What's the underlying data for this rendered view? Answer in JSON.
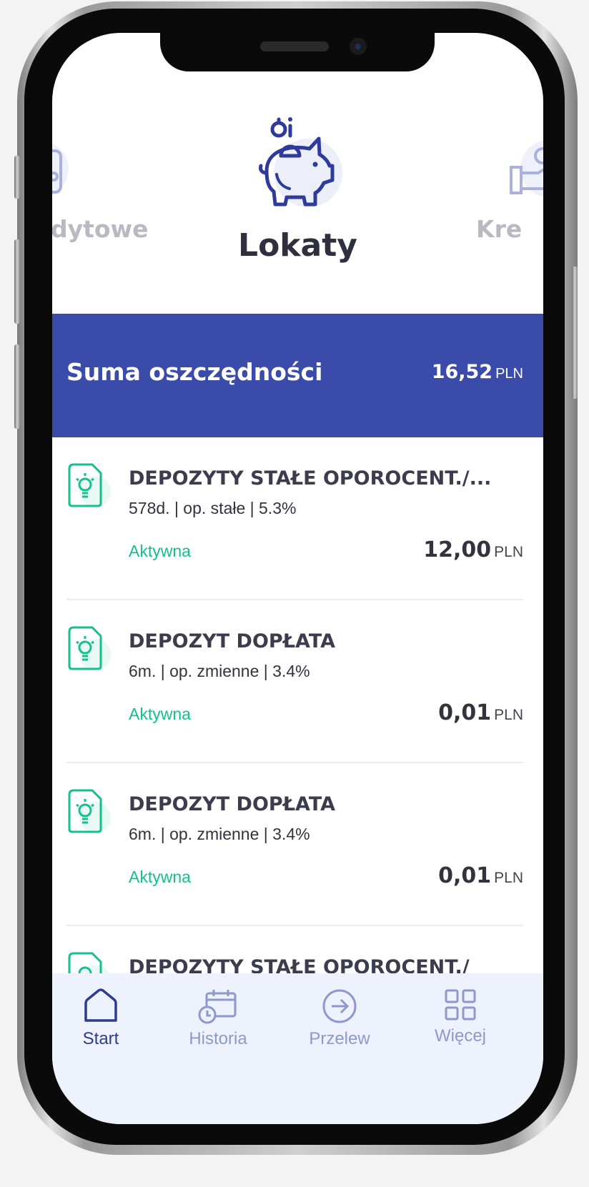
{
  "categories": {
    "left_partial": "dytowe",
    "current": "Lokaty",
    "right_partial": "Kre"
  },
  "summary": {
    "title": "Suma oszczędności",
    "amount": "16,52",
    "currency": "PLN"
  },
  "deposits": [
    {
      "name": "DEPOZYTY STAŁE OPOROCENT./...",
      "details": "578d. | op. stałe | 5.3%",
      "status": "Aktywna",
      "amount": "12,00",
      "currency": "PLN"
    },
    {
      "name": "DEPOZYT DOPŁATA",
      "details": "6m. | op. zmienne | 3.4%",
      "status": "Aktywna",
      "amount": "0,01",
      "currency": "PLN"
    },
    {
      "name": "DEPOZYT DOPŁATA",
      "details": "6m. | op. zmienne | 3.4%",
      "status": "Aktywna",
      "amount": "0,01",
      "currency": "PLN"
    },
    {
      "name": "DEPOZYTY STAŁE OPOROCENT./",
      "details": "",
      "status": "",
      "amount": "",
      "currency": ""
    }
  ],
  "tabs": [
    {
      "label": "Start",
      "icon": "home-icon",
      "active": true
    },
    {
      "label": "Historia",
      "icon": "calendar-clock-icon",
      "active": false
    },
    {
      "label": "Przelew",
      "icon": "arrow-circle-icon",
      "active": false
    },
    {
      "label": "Więcej",
      "icon": "grid-icon",
      "active": false
    }
  ],
  "colors": {
    "accent": "#3a4baa",
    "status_active": "#15c08e",
    "text_dark": "#2f2f40",
    "tab_active": "#2e3b8f",
    "tab_inactive": "#8f98cc",
    "tabbar_bg": "#eef2fc"
  }
}
